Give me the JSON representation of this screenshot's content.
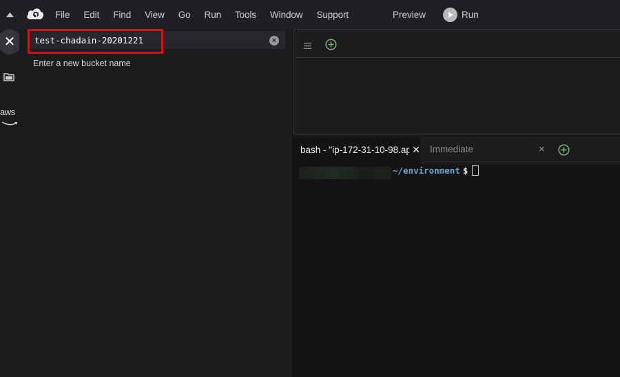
{
  "menubar": {
    "items": [
      "File",
      "Edit",
      "Find",
      "View",
      "Go",
      "Run",
      "Tools",
      "Window",
      "Support"
    ],
    "preview_label": "Preview",
    "run_label": "Run"
  },
  "rail": {
    "aws_label": "aws"
  },
  "panel": {
    "input_value": "test-chadain-20201221",
    "hint": "Enter a new bucket name",
    "highlight_color": "#d3131a"
  },
  "terminal": {
    "tabs": [
      {
        "label": "bash - \"ip-172-31-10-98.ap"
      },
      {
        "label": "Immediate"
      }
    ],
    "prompt_path": "~/environment",
    "prompt_symbol": "$"
  },
  "colors": {
    "accent_green": "#7fb36a",
    "prompt_blue": "#6fa5d8"
  }
}
